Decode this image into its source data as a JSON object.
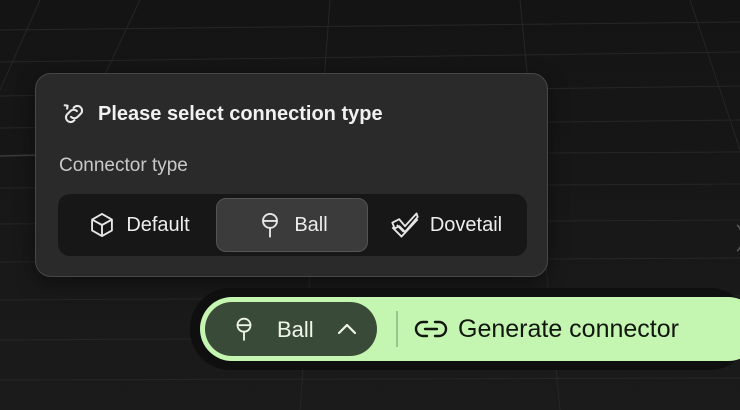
{
  "popover": {
    "title": "Please select connection type",
    "section_label": "Connector type",
    "options": [
      {
        "label": "Default",
        "icon": "cube-icon"
      },
      {
        "label": "Ball",
        "icon": "ball-joint-icon"
      },
      {
        "label": "Dovetail",
        "icon": "dovetail-icon"
      }
    ],
    "selected_option": "Ball"
  },
  "action_bar": {
    "selector_label": "Ball",
    "selector_icon": "ball-joint-icon",
    "generate_label": "Generate connector",
    "generate_icon": "link-icon"
  },
  "colors": {
    "accent": "#c5f6b1",
    "selector_bg": "#3a4a38",
    "panel_bg": "#2a2a2a"
  }
}
